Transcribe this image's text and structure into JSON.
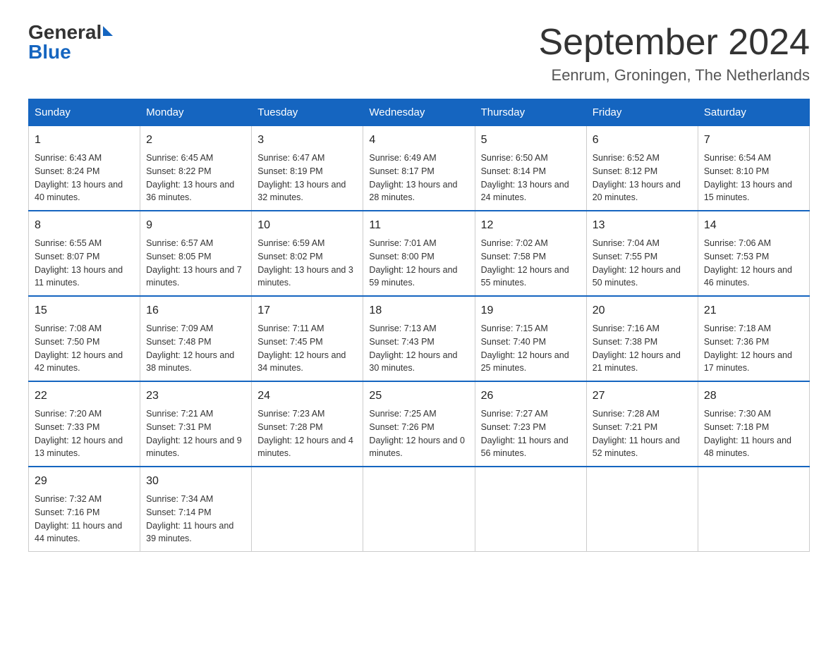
{
  "header": {
    "logo_general": "General",
    "logo_blue": "Blue",
    "month_title": "September 2024",
    "location": "Eenrum, Groningen, The Netherlands"
  },
  "weekdays": [
    "Sunday",
    "Monday",
    "Tuesday",
    "Wednesday",
    "Thursday",
    "Friday",
    "Saturday"
  ],
  "weeks": [
    [
      {
        "day": "1",
        "sunrise": "6:43 AM",
        "sunset": "8:24 PM",
        "daylight": "13 hours and 40 minutes."
      },
      {
        "day": "2",
        "sunrise": "6:45 AM",
        "sunset": "8:22 PM",
        "daylight": "13 hours and 36 minutes."
      },
      {
        "day": "3",
        "sunrise": "6:47 AM",
        "sunset": "8:19 PM",
        "daylight": "13 hours and 32 minutes."
      },
      {
        "day": "4",
        "sunrise": "6:49 AM",
        "sunset": "8:17 PM",
        "daylight": "13 hours and 28 minutes."
      },
      {
        "day": "5",
        "sunrise": "6:50 AM",
        "sunset": "8:14 PM",
        "daylight": "13 hours and 24 minutes."
      },
      {
        "day": "6",
        "sunrise": "6:52 AM",
        "sunset": "8:12 PM",
        "daylight": "13 hours and 20 minutes."
      },
      {
        "day": "7",
        "sunrise": "6:54 AM",
        "sunset": "8:10 PM",
        "daylight": "13 hours and 15 minutes."
      }
    ],
    [
      {
        "day": "8",
        "sunrise": "6:55 AM",
        "sunset": "8:07 PM",
        "daylight": "13 hours and 11 minutes."
      },
      {
        "day": "9",
        "sunrise": "6:57 AM",
        "sunset": "8:05 PM",
        "daylight": "13 hours and 7 minutes."
      },
      {
        "day": "10",
        "sunrise": "6:59 AM",
        "sunset": "8:02 PM",
        "daylight": "13 hours and 3 minutes."
      },
      {
        "day": "11",
        "sunrise": "7:01 AM",
        "sunset": "8:00 PM",
        "daylight": "12 hours and 59 minutes."
      },
      {
        "day": "12",
        "sunrise": "7:02 AM",
        "sunset": "7:58 PM",
        "daylight": "12 hours and 55 minutes."
      },
      {
        "day": "13",
        "sunrise": "7:04 AM",
        "sunset": "7:55 PM",
        "daylight": "12 hours and 50 minutes."
      },
      {
        "day": "14",
        "sunrise": "7:06 AM",
        "sunset": "7:53 PM",
        "daylight": "12 hours and 46 minutes."
      }
    ],
    [
      {
        "day": "15",
        "sunrise": "7:08 AM",
        "sunset": "7:50 PM",
        "daylight": "12 hours and 42 minutes."
      },
      {
        "day": "16",
        "sunrise": "7:09 AM",
        "sunset": "7:48 PM",
        "daylight": "12 hours and 38 minutes."
      },
      {
        "day": "17",
        "sunrise": "7:11 AM",
        "sunset": "7:45 PM",
        "daylight": "12 hours and 34 minutes."
      },
      {
        "day": "18",
        "sunrise": "7:13 AM",
        "sunset": "7:43 PM",
        "daylight": "12 hours and 30 minutes."
      },
      {
        "day": "19",
        "sunrise": "7:15 AM",
        "sunset": "7:40 PM",
        "daylight": "12 hours and 25 minutes."
      },
      {
        "day": "20",
        "sunrise": "7:16 AM",
        "sunset": "7:38 PM",
        "daylight": "12 hours and 21 minutes."
      },
      {
        "day": "21",
        "sunrise": "7:18 AM",
        "sunset": "7:36 PM",
        "daylight": "12 hours and 17 minutes."
      }
    ],
    [
      {
        "day": "22",
        "sunrise": "7:20 AM",
        "sunset": "7:33 PM",
        "daylight": "12 hours and 13 minutes."
      },
      {
        "day": "23",
        "sunrise": "7:21 AM",
        "sunset": "7:31 PM",
        "daylight": "12 hours and 9 minutes."
      },
      {
        "day": "24",
        "sunrise": "7:23 AM",
        "sunset": "7:28 PM",
        "daylight": "12 hours and 4 minutes."
      },
      {
        "day": "25",
        "sunrise": "7:25 AM",
        "sunset": "7:26 PM",
        "daylight": "12 hours and 0 minutes."
      },
      {
        "day": "26",
        "sunrise": "7:27 AM",
        "sunset": "7:23 PM",
        "daylight": "11 hours and 56 minutes."
      },
      {
        "day": "27",
        "sunrise": "7:28 AM",
        "sunset": "7:21 PM",
        "daylight": "11 hours and 52 minutes."
      },
      {
        "day": "28",
        "sunrise": "7:30 AM",
        "sunset": "7:18 PM",
        "daylight": "11 hours and 48 minutes."
      }
    ],
    [
      {
        "day": "29",
        "sunrise": "7:32 AM",
        "sunset": "7:16 PM",
        "daylight": "11 hours and 44 minutes."
      },
      {
        "day": "30",
        "sunrise": "7:34 AM",
        "sunset": "7:14 PM",
        "daylight": "11 hours and 39 minutes."
      },
      null,
      null,
      null,
      null,
      null
    ]
  ],
  "labels": {
    "sunrise": "Sunrise:",
    "sunset": "Sunset:",
    "daylight": "Daylight:"
  }
}
